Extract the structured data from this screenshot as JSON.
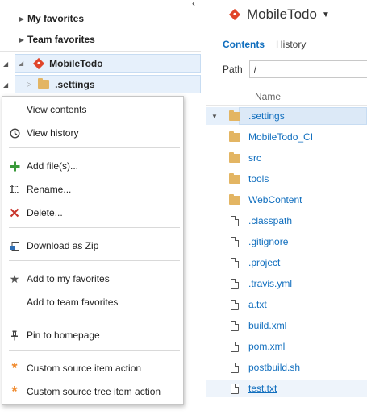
{
  "left": {
    "my_favorites": "My favorites",
    "team_favorites": "Team favorites",
    "repo_name": "MobileTodo",
    "settings_folder": ".settings"
  },
  "menu": {
    "items": [
      {
        "label": "View contents",
        "icon": "none"
      },
      {
        "label": "View history",
        "icon": "history-icon"
      },
      {
        "label": "Add file(s)...",
        "icon": "plus-icon"
      },
      {
        "label": "Rename...",
        "icon": "rename-icon"
      },
      {
        "label": "Delete...",
        "icon": "delete-x-icon"
      },
      {
        "label": "Download as Zip",
        "icon": "download-zip-icon"
      },
      {
        "label": "Add to my favorites",
        "icon": "star-icon"
      },
      {
        "label": "Add to team favorites",
        "icon": "none"
      },
      {
        "label": "Pin to homepage",
        "icon": "pin-icon"
      },
      {
        "label": "Custom source item action",
        "icon": "asterisk-icon"
      },
      {
        "label": "Custom source tree item action",
        "icon": "asterisk-icon"
      }
    ]
  },
  "right": {
    "repo_title": "MobileTodo",
    "tabs": [
      "Contents",
      "History"
    ],
    "path_label": "Path",
    "path_value": "/",
    "column_name": "Name",
    "files": [
      {
        "name": ".settings",
        "type": "folder"
      },
      {
        "name": "MobileTodo_CI",
        "type": "folder"
      },
      {
        "name": "src",
        "type": "folder"
      },
      {
        "name": "tools",
        "type": "folder"
      },
      {
        "name": "WebContent",
        "type": "folder"
      },
      {
        "name": ".classpath",
        "type": "file"
      },
      {
        "name": ".gitignore",
        "type": "file"
      },
      {
        "name": ".project",
        "type": "file"
      },
      {
        "name": ".travis.yml",
        "type": "file"
      },
      {
        "name": "a.txt",
        "type": "file"
      },
      {
        "name": "build.xml",
        "type": "file"
      },
      {
        "name": "pom.xml",
        "type": "file"
      },
      {
        "name": "postbuild.sh",
        "type": "file"
      },
      {
        "name": "test.txt",
        "type": "file"
      }
    ]
  },
  "colors": {
    "accent": "#106ebe",
    "selection": "#e6f0fb",
    "git": "#e0452a",
    "folder": "#e3b563",
    "add_green": "#3a9a3a",
    "delete_red": "#c8352c",
    "custom_orange": "#f0882a"
  }
}
